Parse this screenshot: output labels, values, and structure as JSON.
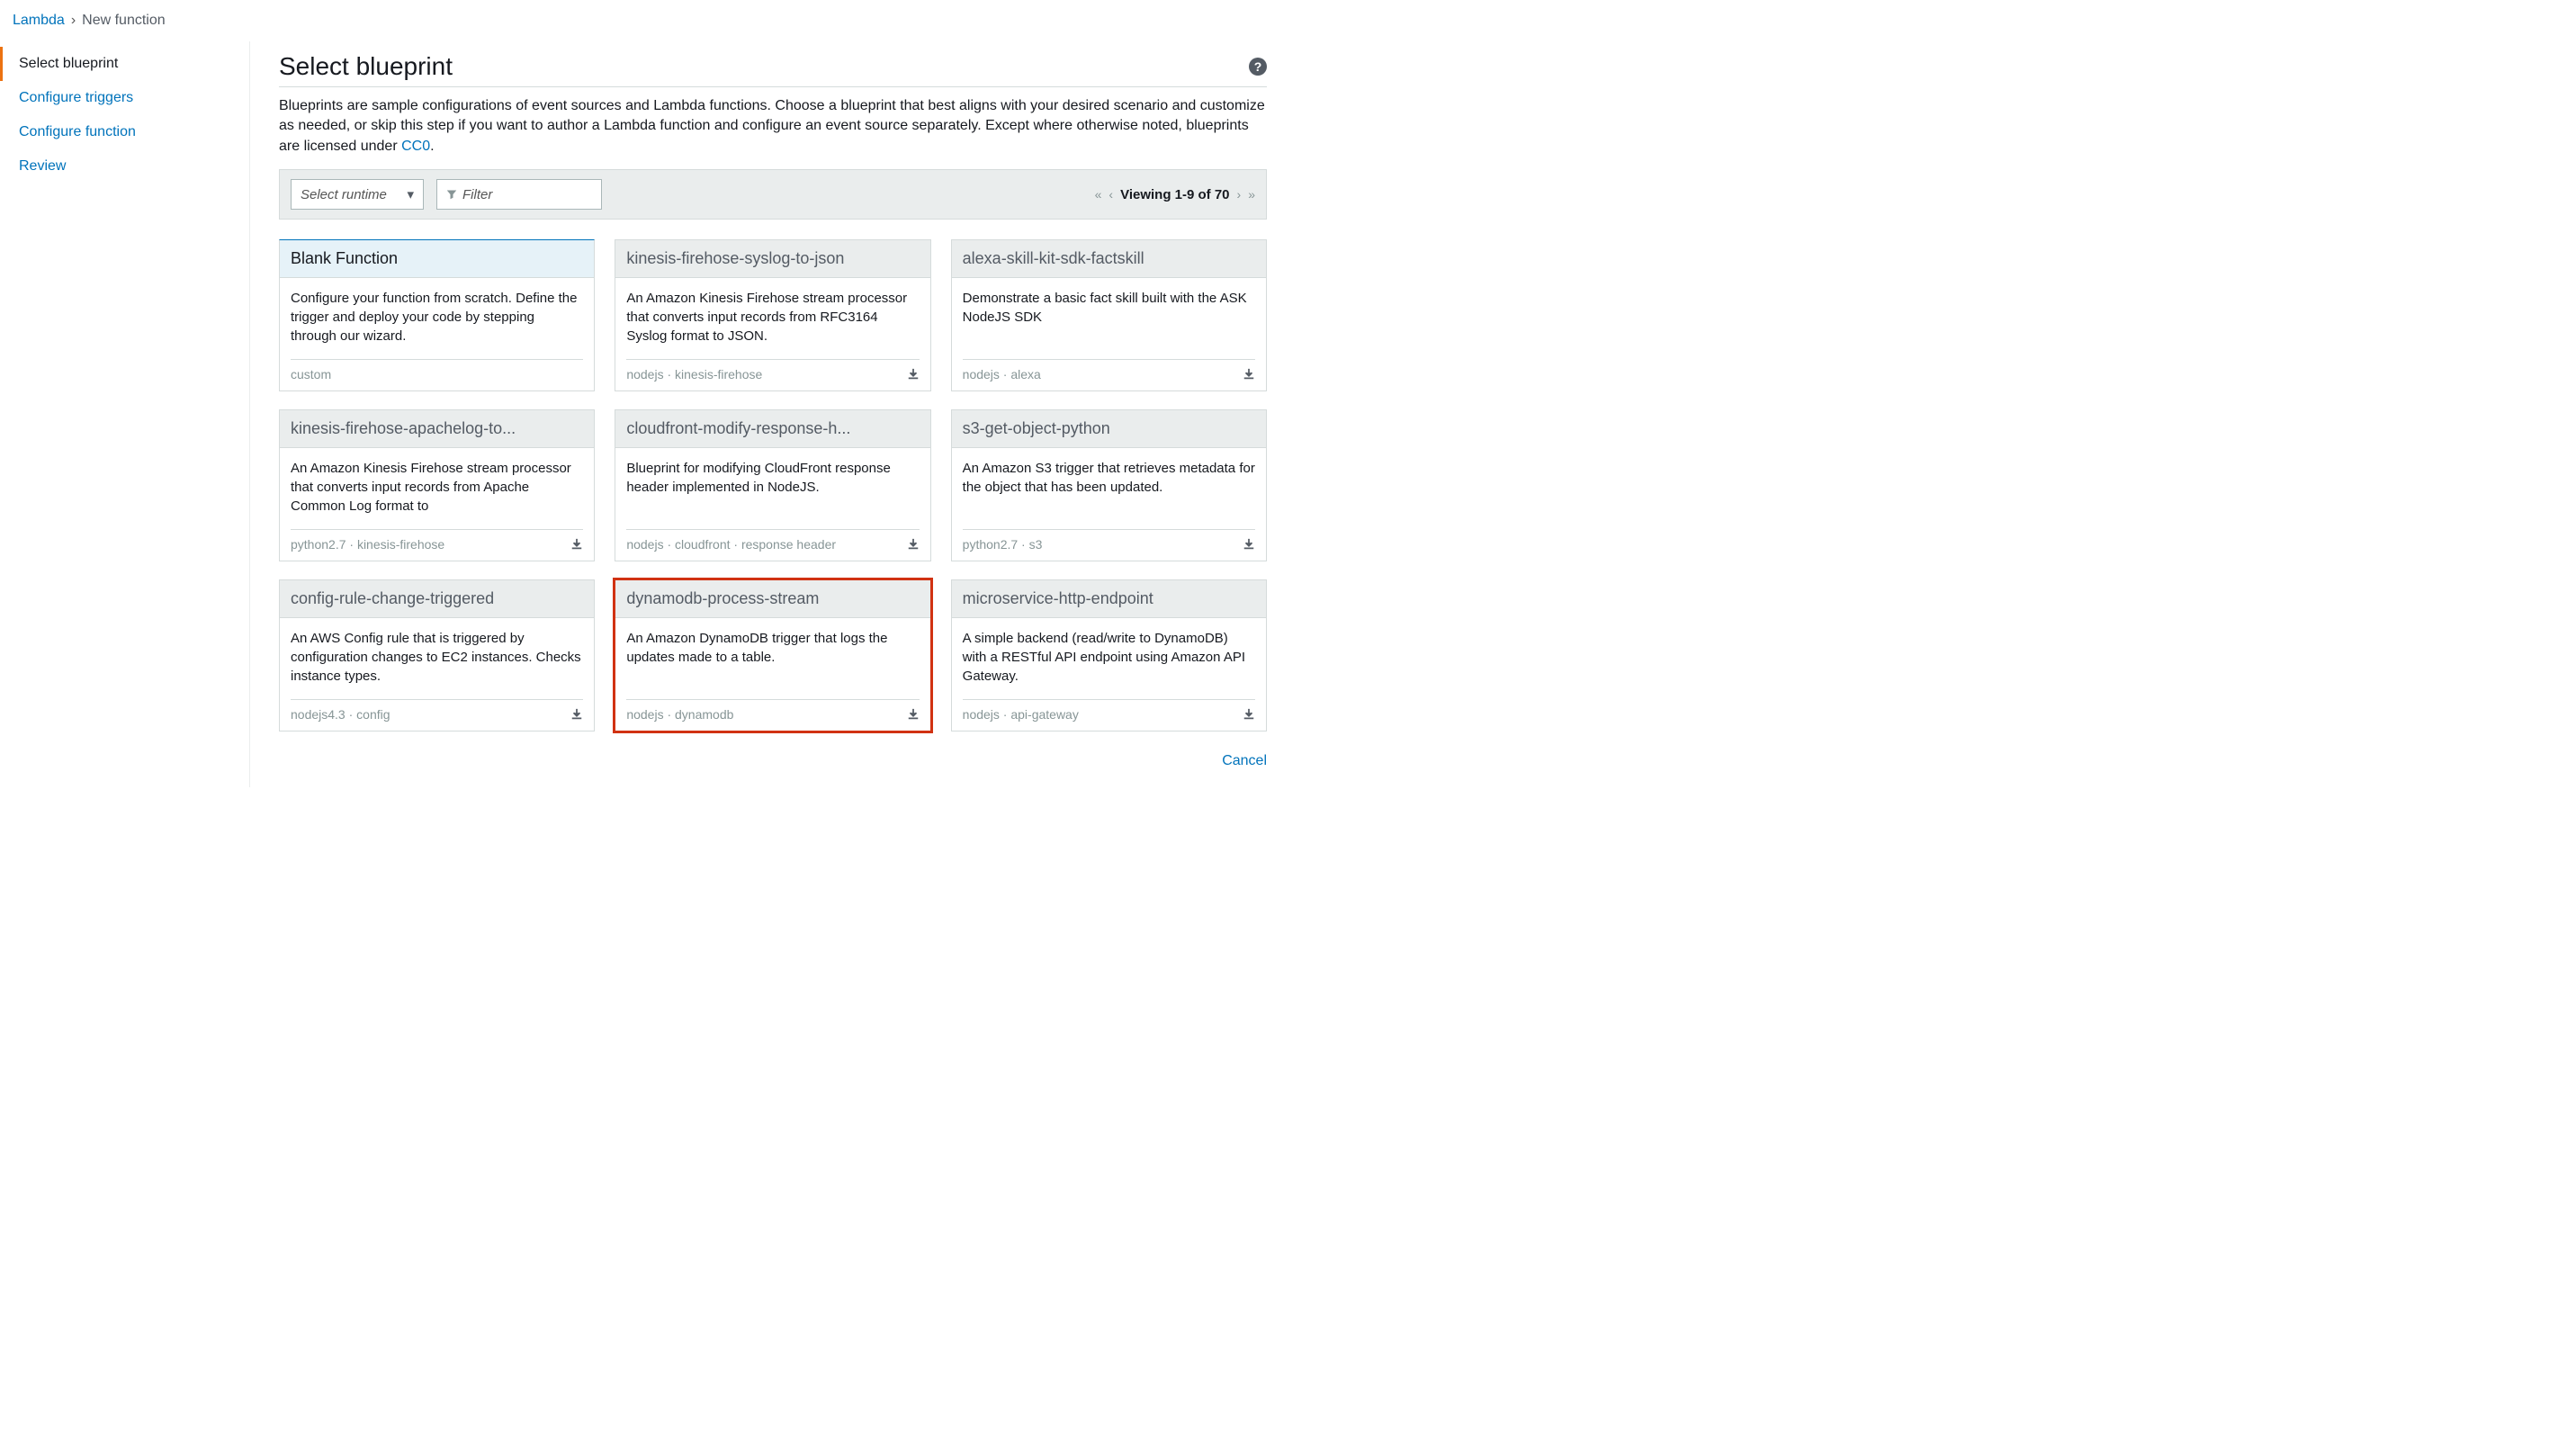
{
  "breadcrumb": {
    "root": "Lambda",
    "current": "New function"
  },
  "wizard": {
    "items": [
      {
        "label": "Select blueprint",
        "active": true
      },
      {
        "label": "Configure triggers",
        "active": false
      },
      {
        "label": "Configure function",
        "active": false
      },
      {
        "label": "Review",
        "active": false
      }
    ]
  },
  "header": {
    "title": "Select blueprint",
    "help_tooltip": "?",
    "description_before_link": "Blueprints are sample configurations of event sources and Lambda functions. Choose a blueprint that best aligns with your desired scenario and customize as needed, or skip this step if you want to author a Lambda function and configure an event source separately. Except where otherwise noted, blueprints are licensed under ",
    "license_link": "CC0",
    "description_after_link": "."
  },
  "filter": {
    "runtime_placeholder": "Select runtime",
    "filter_placeholder": "Filter",
    "viewing": "Viewing 1-9 of 70"
  },
  "cards": [
    {
      "title": "Blank Function",
      "desc": "Configure your function from scratch. Define the trigger and deploy your code by stepping through our wizard.",
      "tags": "custom",
      "download": false,
      "selected": true,
      "highlighted": false
    },
    {
      "title": "kinesis-firehose-syslog-to-json",
      "desc": "An Amazon Kinesis Firehose stream processor that converts input records from RFC3164 Syslog format to JSON.",
      "tags": "nodejs · kinesis-firehose",
      "download": true,
      "selected": false,
      "highlighted": false
    },
    {
      "title": "alexa-skill-kit-sdk-factskill",
      "desc": "Demonstrate a basic fact skill built with the ASK NodeJS SDK",
      "tags": "nodejs · alexa",
      "download": true,
      "selected": false,
      "highlighted": false
    },
    {
      "title": "kinesis-firehose-apachelog-to...",
      "desc": "An Amazon Kinesis Firehose stream processor that converts input records from Apache Common Log format to",
      "tags": "python2.7 · kinesis-firehose",
      "download": true,
      "selected": false,
      "highlighted": false
    },
    {
      "title": "cloudfront-modify-response-h...",
      "desc": "Blueprint for modifying CloudFront response header implemented in NodeJS.",
      "tags": "nodejs · cloudfront · response header",
      "download": true,
      "selected": false,
      "highlighted": false
    },
    {
      "title": "s3-get-object-python",
      "desc": "An Amazon S3 trigger that retrieves metadata for the object that has been updated.",
      "tags": "python2.7 · s3",
      "download": true,
      "selected": false,
      "highlighted": false
    },
    {
      "title": "config-rule-change-triggered",
      "desc": "An AWS Config rule that is triggered by configuration changes to EC2 instances. Checks instance types.",
      "tags": "nodejs4.3 · config",
      "download": true,
      "selected": false,
      "highlighted": false
    },
    {
      "title": "dynamodb-process-stream",
      "desc": "An Amazon DynamoDB trigger that logs the updates made to a table.",
      "tags": "nodejs · dynamodb",
      "download": true,
      "selected": false,
      "highlighted": true
    },
    {
      "title": "microservice-http-endpoint",
      "desc": "A simple backend (read/write to DynamoDB) with a RESTful API endpoint using Amazon API Gateway.",
      "tags": "nodejs · api-gateway",
      "download": true,
      "selected": false,
      "highlighted": false
    }
  ],
  "footer": {
    "cancel": "Cancel"
  }
}
